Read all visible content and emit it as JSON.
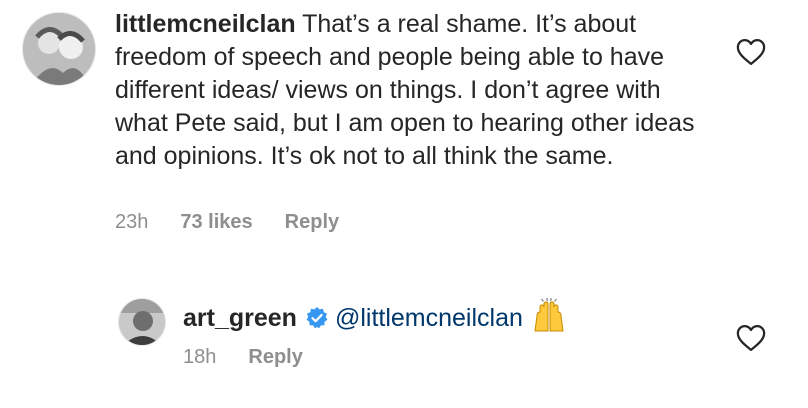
{
  "comment1": {
    "username": "littlemcneilclan",
    "text": "That’s a real shame. It’s about freedom of speech and people being able to have different ideas/ views on things. I don’t agree with what Pete said, but I am open to hearing other ideas and opinions. It’s ok not to all think the same.",
    "time": "23h",
    "likes": "73 likes",
    "reply_label": "Reply"
  },
  "comment2": {
    "username": "art_green",
    "mention": "@littlemcneilclan",
    "time": "18h",
    "reply_label": "Reply"
  },
  "icons": {
    "like": "heart-outline-icon",
    "verified": "verified-badge-icon",
    "emoji": "raising-hands-emoji"
  },
  "colors": {
    "text": "#262626",
    "secondary": "#8e8e8e",
    "mention": "#00376b",
    "verified": "#3897f0"
  }
}
